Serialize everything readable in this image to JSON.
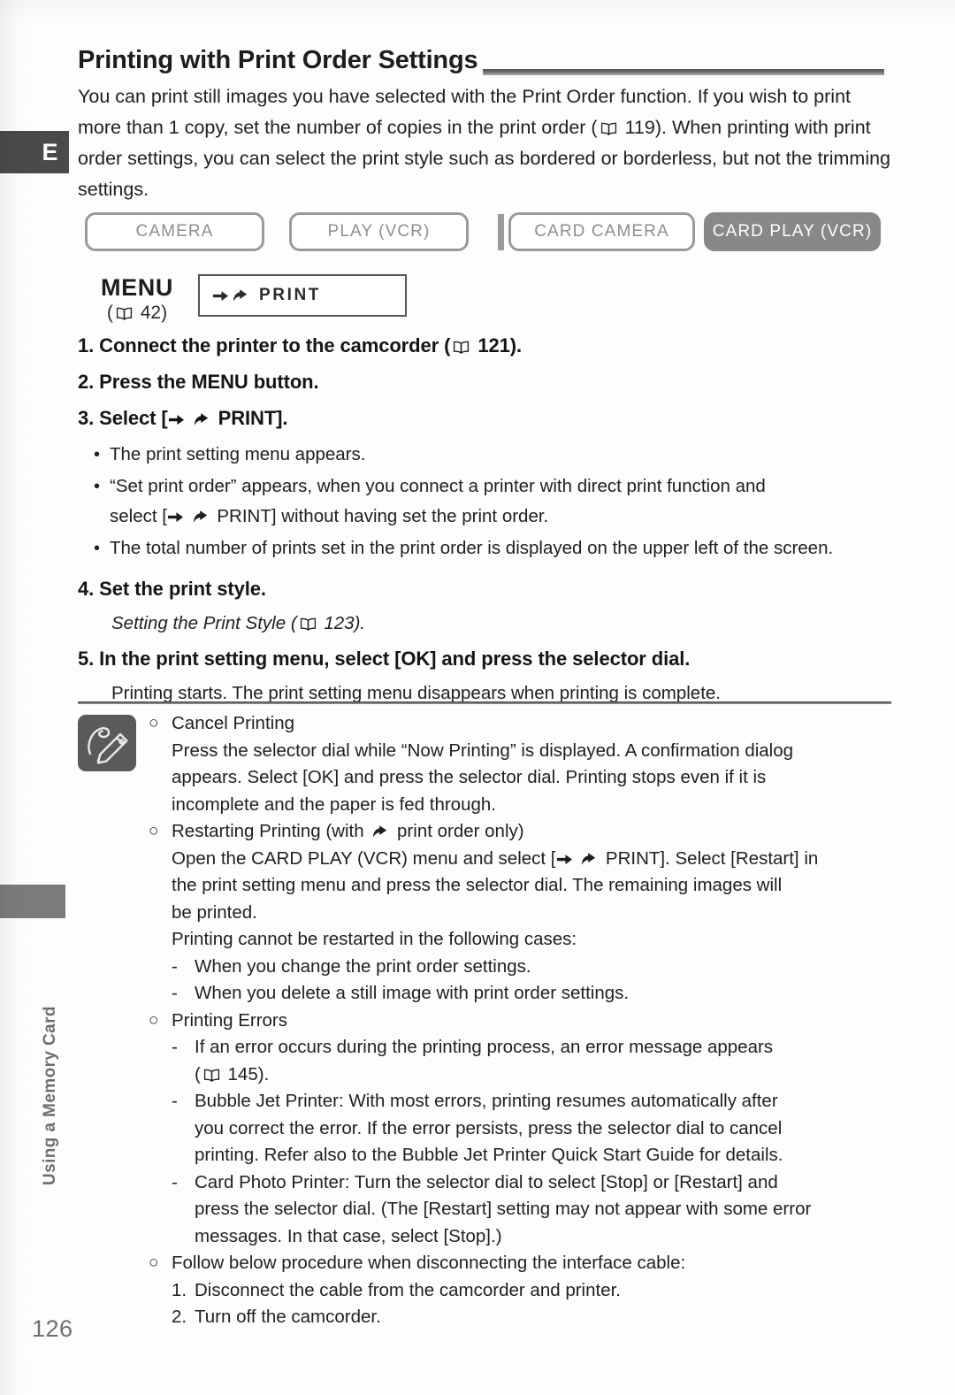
{
  "document": {
    "page_number": "126",
    "chapter_tab_letter": "E",
    "side_tab_text": "Using a Memory Card"
  },
  "header": {
    "title": "Printing with Print Order Settings"
  },
  "intro": {
    "line1_a": "You can print still images you have selected with the Print Order function. If you wish",
    "line2_a": "to print more than 1 copy, set the number of copies in the print order (",
    "line2_ref": "119",
    "line2_b": ").",
    "line3": "When printing with print order settings, you can select the print style such as",
    "line4": "bordered or borderless, but not the trimming settings."
  },
  "mode_bar": {
    "buttons": [
      {
        "label": "CAMERA",
        "active": false
      },
      {
        "label": "PLAY (VCR)",
        "active": false
      },
      {
        "label": "CARD CAMERA",
        "active": false
      },
      {
        "label": "CARD PLAY (VCR)",
        "active": true
      }
    ]
  },
  "menu_block": {
    "menu_word": "MENU",
    "menu_ref_open": "(",
    "menu_ref_page": "42",
    "menu_ref_close": ")",
    "menu_item_label": "PRINT"
  },
  "steps": {
    "step1_a": "1. Connect the printer to the camcorder (",
    "step1_ref": "121",
    "step1_b": ").",
    "step2": "2. Press the MENU button.",
    "step3_a": "3. Select [",
    "step3_b": "PRINT].",
    "bullets": [
      {
        "text": "The print setting menu appears."
      },
      {
        "text": "“Set print order” appears, when you connect a printer with direct print function and"
      },
      {
        "text": "The total number of prints set in the print order is displayed on the upper left of the screen."
      }
    ],
    "bullet2_cont_a": "select [",
    "bullet2_cont_b": "PRINT] without having set the print order.",
    "step4": "4. Set the print style.",
    "step4_sub_a": "Setting the Print Style (",
    "step4_sub_ref": "123",
    "step4_sub_b": ").",
    "step5": "5. In the print setting menu, select [OK] and press the selector dial.",
    "step5_sub": "Printing starts. The print setting menu disappears when printing is complete."
  },
  "notes": {
    "cancel_heading": "Cancel Printing",
    "cancel_l1": "Press the selector dial while “Now Printing” is displayed. A confirmation dialog",
    "cancel_l2": "appears. Select [OK] and press the selector dial. Printing stops even if it is",
    "cancel_l3": "incomplete and the paper is fed through.",
    "restart_heading_a": "Restarting Printing (with",
    "restart_heading_b": "print order only)",
    "restart_l1_a": "Open the CARD PLAY (VCR) menu and select [",
    "restart_l1_b": "PRINT]. Select [Restart] in",
    "restart_l2": "the print setting menu and press the selector dial. The remaining images will",
    "restart_l3": "be printed.",
    "restart_l4": "Printing cannot be restarted in the following cases:",
    "restart_case1": "When you change the print order settings.",
    "restart_case2": "When you delete a still image with print order settings.",
    "errors_heading": "Printing Errors",
    "error1_l1": "If an error occurs during the printing process, an error message appears",
    "error1_l2_a": "(",
    "error1_l2_ref": "145",
    "error1_l2_b": ").",
    "error2_l1": "Bubble Jet Printer: With most errors, printing resumes automatically after",
    "error2_l2": "you correct the error. If the error persists, press the selector dial to cancel",
    "error2_l3": "printing. Refer also to the Bubble Jet Printer Quick Start Guide for details.",
    "error3_l1": "Card Photo Printer: Turn the selector dial to select [Stop] or [Restart] and",
    "error3_l2": "press the selector dial. (The [Restart] setting may not appear with some error",
    "error3_l3": "messages. In that case, select [Stop].)",
    "disconnect_heading": "Follow below procedure when disconnecting the interface cable:",
    "disconnect_1_num": "1.",
    "disconnect_1_text": "Disconnect the cable from the camcorder and printer.",
    "disconnect_2_num": "2.",
    "disconnect_2_text": "Turn off the camcorder.",
    "ring_glyph": "○",
    "dash_glyph": "-"
  }
}
